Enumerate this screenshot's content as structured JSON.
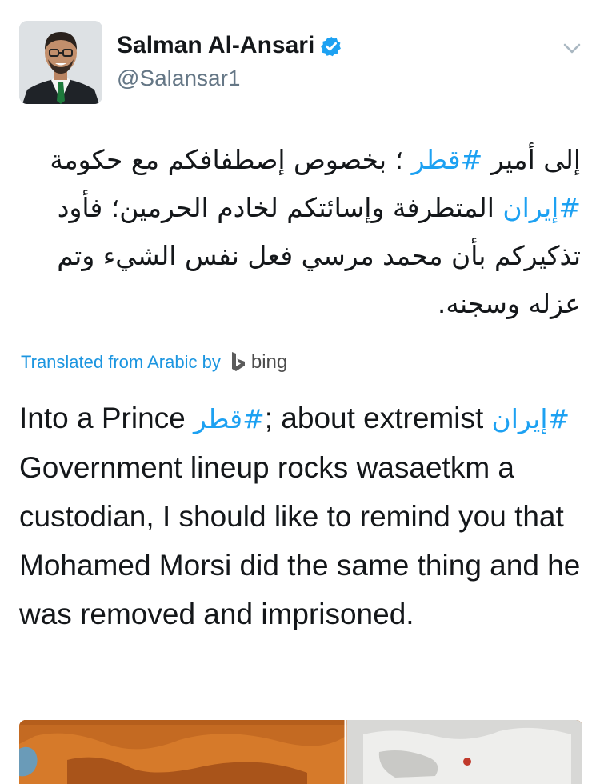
{
  "tweet": {
    "author": {
      "name": "Salman Al-Ansari",
      "handle": "@Salansar1",
      "verified_color": "#1da1f2"
    },
    "original_text": {
      "before_tag1": "إلى أمير ",
      "tag1": "#قطر",
      "middle": " ؛ بخصوص إصطفافكم مع حكومة ",
      "tag2": "#إيران",
      "after_tag2": " المتطرفة وإسائتكم لخادم الحرمين؛ فأود تذكيركم بأن محمد مرسي فعل نفس الشيء وتم عزله وسجنه."
    },
    "translation": {
      "label": "Translated from Arabic by",
      "provider": "bing",
      "provider_icon": "bing-logo-icon",
      "prefix": "Into a Prince ",
      "tag1": "قطر#",
      "mid": "; about extremist ",
      "tag2": "إيران#",
      "rest": " Government lineup rocks wasaetkm a custodian, I should like to remind you that Mohamed Morsi did the same thing and he was removed and imprisoned."
    },
    "icons": {
      "verified": "verified-badge-icon",
      "menu": "chevron-down-icon"
    },
    "colors": {
      "link": "#1da1f2",
      "translation_label": "#1b95e0",
      "text": "#14171a",
      "secondary": "#657786"
    }
  }
}
